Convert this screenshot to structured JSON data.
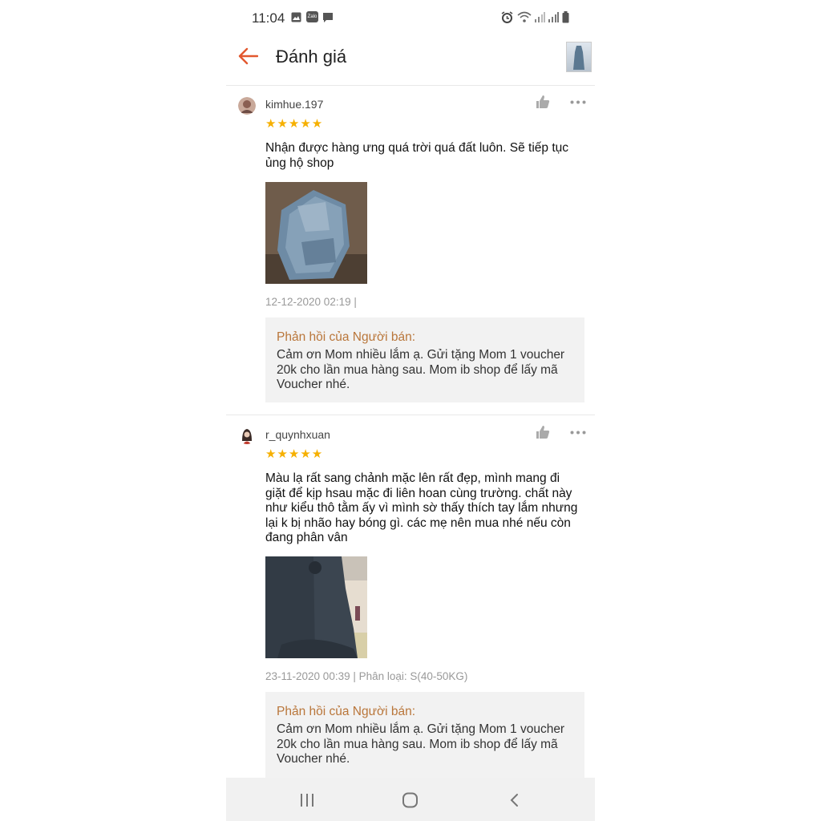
{
  "status_bar": {
    "time": "11:04",
    "zalo_label": "Zalo"
  },
  "header": {
    "title": "Đánh giá"
  },
  "reviews": [
    {
      "username": "kimhue.197",
      "stars": "★★★★★",
      "text": "Nhận được hàng ưng quá trời quá đất luôn.  Sẽ tiếp tục ủng hộ shop",
      "meta": "12-12-2020 02:19 |",
      "reply_title": "Phản hồi của Người bán:",
      "reply_text": "Cảm ơn Mom nhiều lắm ạ. Gửi tặng Mom 1 voucher 20k cho lần mua hàng sau. Mom ib shop để lấy mã Voucher nhé."
    },
    {
      "username": "r_quynhxuan",
      "stars": "★★★★★",
      "text": "Màu lạ rất sang chảnh mặc lên rất đẹp, mình mang đi giặt để kịp hsau mặc đi liên hoan cùng trường. chất này như kiểu thô tằm ấy vì mình sờ thấy thích tay lắm nhưng lại k bị nhão hay bóng gì. các mẹ nên mua nhé nếu còn đang phân vân",
      "meta": "23-11-2020 00:39 | Phân loại: S(40-50KG)",
      "reply_title": "Phản hồi của Người bán:",
      "reply_text": "Cảm ơn Mom nhiều lắm ạ. Gửi tặng Mom 1 voucher 20k cho lần mua hàng sau. Mom ib shop để lấy mã Voucher nhé."
    }
  ],
  "colors": {
    "accent": "#e2582f",
    "star": "#f6b000",
    "reply_title": "#b9763a",
    "reply_bg": "#f2f2f2"
  }
}
